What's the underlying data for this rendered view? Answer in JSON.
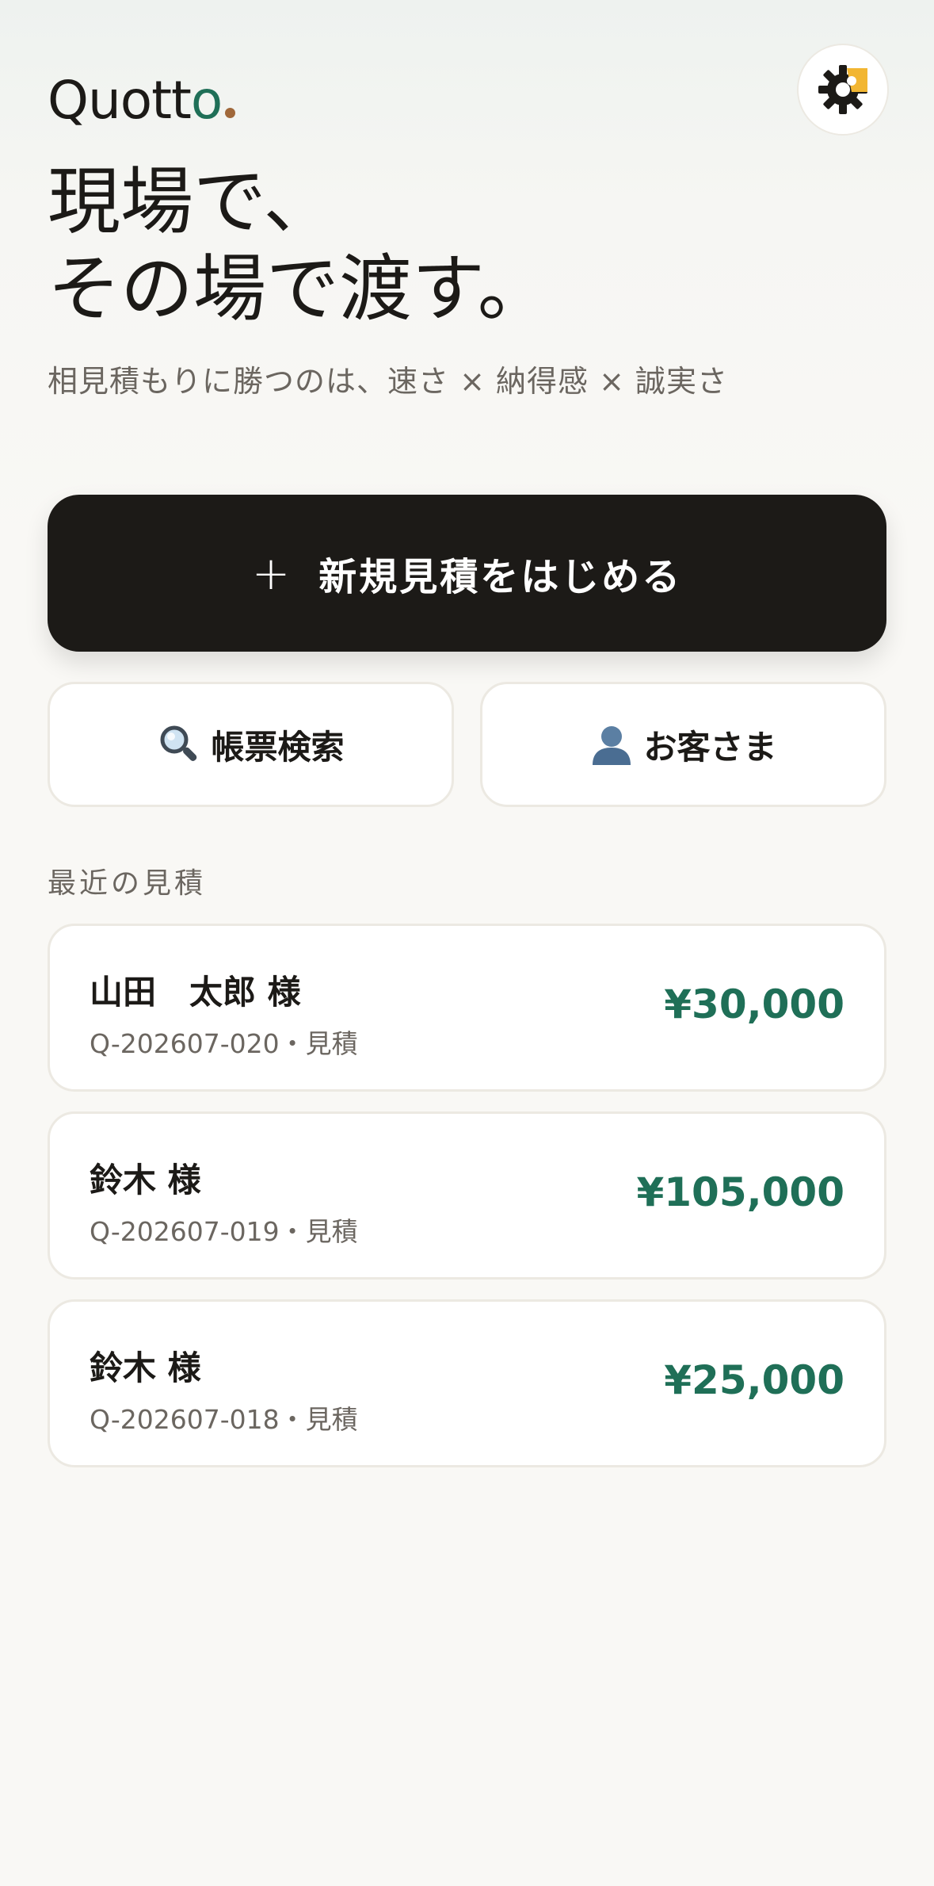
{
  "app": {
    "logo_main": "Quott",
    "logo_accent": "o",
    "theme_toggle_icon": "theme-toggle-gear-icon"
  },
  "hero": {
    "title_line1": "現場で、",
    "title_line2": "その場で渡す。",
    "tagline": "相見積もりに勝つのは、速さ × 納得感 × 誠実さ"
  },
  "actions": {
    "new_quote_icon": "+",
    "new_quote_label": "新規見積をはじめる",
    "search_label": "帳票検索",
    "customers_label": "お客さま"
  },
  "recent": {
    "title": "最近の見積",
    "items": [
      {
        "name": "山田　太郎 様",
        "meta": "Q-202607-020・見積",
        "amount": "¥30,000"
      },
      {
        "name": "鈴木 様",
        "meta": "Q-202607-019・見積",
        "amount": "¥105,000"
      },
      {
        "name": "鈴木 様",
        "meta": "Q-202607-018・見積",
        "amount": "¥25,000"
      }
    ]
  },
  "colors": {
    "accent_green": "#1f6f57",
    "logo_dot": "#a0683a",
    "primary_button": "#1c1a17",
    "theme_sun": "#f2b632"
  }
}
